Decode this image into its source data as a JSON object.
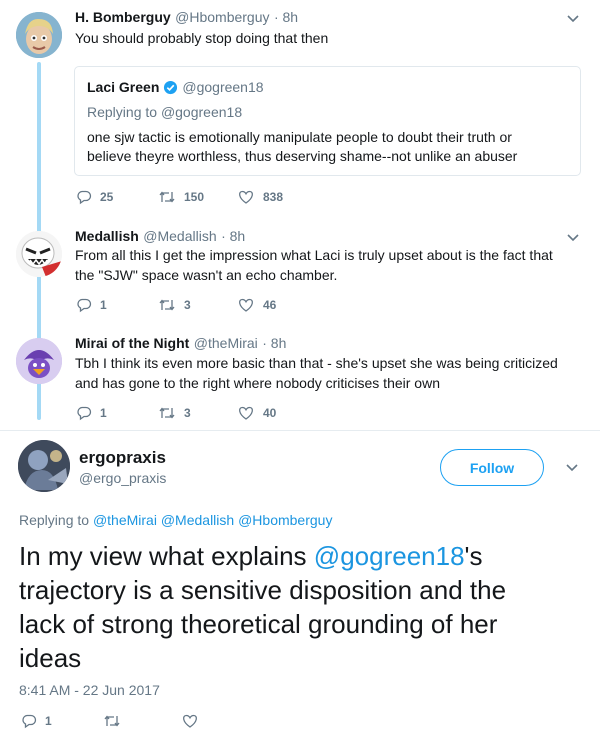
{
  "tweets": [
    {
      "name": "H. Bomberguy",
      "handle": "@Hbomberguy",
      "time": "· 8h",
      "text": "You should probably stop doing that then",
      "quote": {
        "name": "Laci Green",
        "handle": "@gogreen18",
        "replying_prefix": "Replying to",
        "replying_to": "@gogreen18",
        "text": "one sjw tactic is emotionally manipulate people to doubt their truth or believe theyre worthless, thus deserving shame--not unlike an abuser"
      },
      "replies": "25",
      "retweets": "150",
      "likes": "838"
    },
    {
      "name": "Medallish",
      "handle": "@Medallish",
      "time": "· 8h",
      "text_line1": "From all this I get the impression what Laci is truly upset about is the fact that",
      "text_line2": "the \"SJW\" space wasn't an echo chamber.",
      "replies": "1",
      "retweets": "3",
      "likes": "46"
    },
    {
      "name": "Mirai of the Night",
      "handle": "@theMirai",
      "time": "· 8h",
      "text_line1": "Tbh I think its even more basic than that - she's upset she was being criticized",
      "text_line2": "and has gone to the right where nobody criticises their own",
      "replies": "1",
      "retweets": "3",
      "likes": "40"
    }
  ],
  "main_tweet": {
    "name": "ergopraxis",
    "handle": "@ergo_praxis",
    "follow_label": "Follow",
    "replying_prefix": "Replying to",
    "replying_to": [
      "@theMirai",
      "@Medallish",
      "@Hbomberguy"
    ],
    "text_before": "In my view what explains ",
    "text_mention": "@gogreen18",
    "text_line1_after": "'s",
    "text_line2": "trajectory is a sensitive disposition and the",
    "text_line3": "lack of strong theoretical grounding of her",
    "text_line4": "ideas",
    "timestamp": "8:41 AM - 22 Jun 2017",
    "replies": "1"
  },
  "colors": {
    "link": "#1b95e0",
    "thread_line": "#a4d9f5",
    "verified": "#1da1f2",
    "muted": "#657786"
  }
}
